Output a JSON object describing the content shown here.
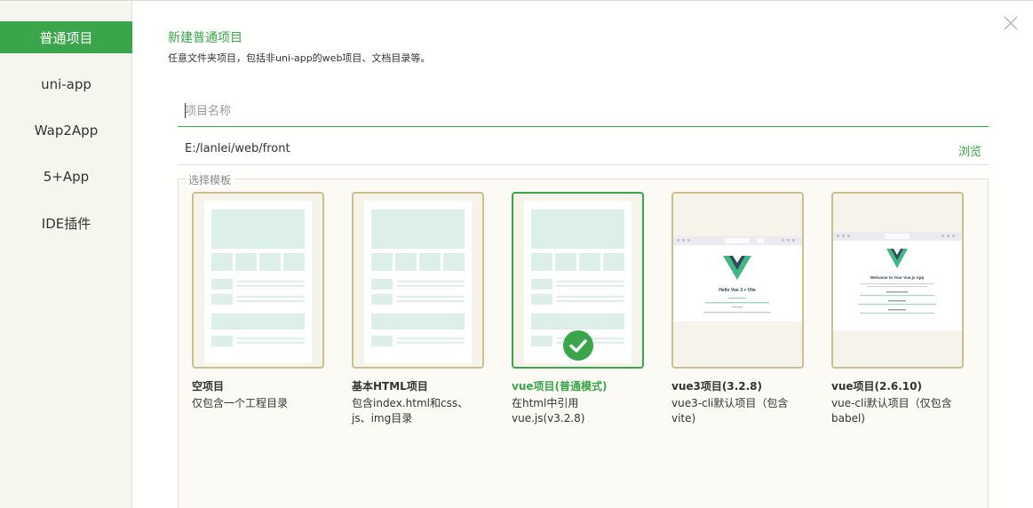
{
  "sidebar": {
    "items": [
      {
        "label": "普通项目"
      },
      {
        "label": "uni-app"
      },
      {
        "label": "Wap2App"
      },
      {
        "label": "5+App"
      },
      {
        "label": "IDE插件"
      }
    ]
  },
  "header": {
    "title": "新建普通项目",
    "subtitle": "任意文件夹项目，包括非uni-app的web项目、文档目录等。"
  },
  "form": {
    "name_placeholder": "项目名称",
    "name_value": "",
    "path": "E:/lanlei/web/front",
    "browse_label": "浏览"
  },
  "templates": {
    "legend": "选择模板",
    "items": [
      {
        "title": "空项目",
        "desc": "仅包含一个工程目录",
        "selected": false
      },
      {
        "title": "基本HTML项目",
        "desc": "包含index.html和css、js、img目录",
        "selected": false
      },
      {
        "title": "vue项目(普通模式)",
        "desc": "在html中引用vue.js(v3.2.8)",
        "selected": true
      },
      {
        "title": "vue3项目(3.2.8)",
        "desc": "vue3-cli默认项目（包含vite)",
        "selected": false
      },
      {
        "title": "vue项目(2.6.10)",
        "desc": "vue-cli默认项目（仅包含babel)",
        "selected": false
      }
    ],
    "previews": {
      "vue3": {
        "heading": "Hello Vue 3 + Vite"
      },
      "vue2": {
        "heading": "Welcome to Your Vue.js App"
      }
    }
  },
  "colors": {
    "accent": "#3aa54a",
    "card_border": "#c9bf8f",
    "sidebar_bg": "#f7f6ee"
  }
}
